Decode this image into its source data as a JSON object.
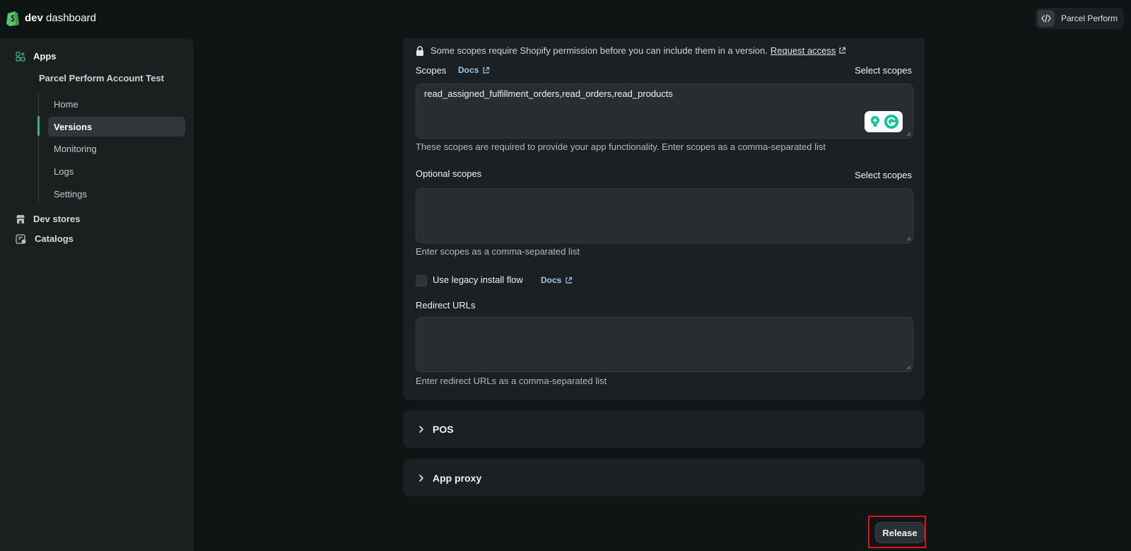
{
  "header": {
    "brand_bold": "dev",
    "brand_rest": "dashboard",
    "account_name": "Parcel Perform"
  },
  "sidebar": {
    "apps_label": "Apps",
    "app_name": "Parcel Perform Account Test",
    "items": [
      {
        "label": "Home",
        "active": false
      },
      {
        "label": "Versions",
        "active": true
      },
      {
        "label": "Monitoring",
        "active": false
      },
      {
        "label": "Logs",
        "active": false
      },
      {
        "label": "Settings",
        "active": false
      }
    ],
    "dev_stores_label": "Dev stores",
    "catalogs_label": "Catalogs"
  },
  "access": {
    "notice_text": "Some scopes require Shopify permission before you can include them in a version.",
    "request_access_link": "Request access"
  },
  "scopes": {
    "label": "Scopes",
    "docs_link": "Docs",
    "select_label": "Select scopes",
    "value": "read_assigned_fulfillment_orders,read_orders,read_products",
    "help": "These scopes are required to provide your app functionality. Enter scopes as a comma-separated list"
  },
  "optional_scopes": {
    "label": "Optional scopes",
    "select_label": "Select scopes",
    "value": "",
    "help": "Enter scopes as a comma-separated list"
  },
  "legacy_install": {
    "label": "Use legacy install flow",
    "docs_link": "Docs",
    "checked": false
  },
  "redirect_urls": {
    "label": "Redirect URLs",
    "value": "",
    "help": "Enter redirect URLs as a comma-separated list"
  },
  "sections": {
    "pos_label": "POS",
    "app_proxy_label": "App proxy"
  },
  "actions": {
    "release_label": "Release"
  },
  "colors": {
    "accent": "#3fb37f",
    "link": "#9ec6f2",
    "highlight_box": "#e3121a"
  }
}
